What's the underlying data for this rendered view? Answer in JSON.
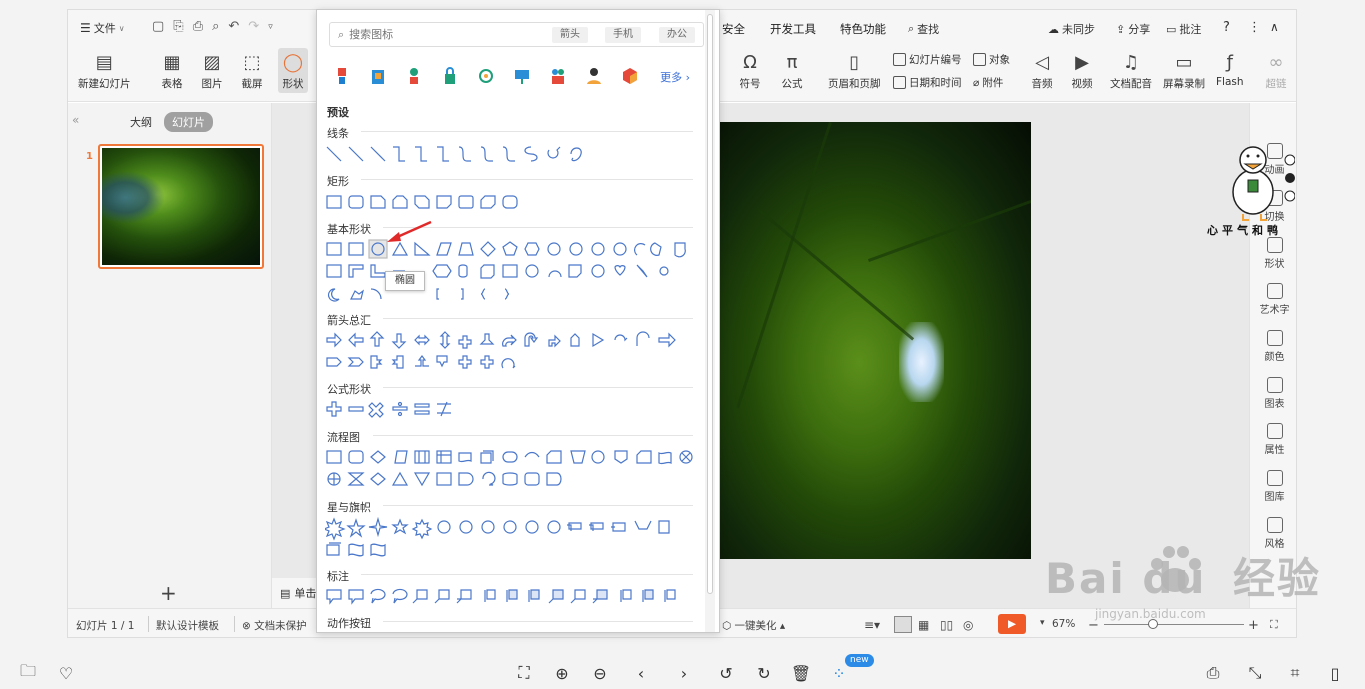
{
  "topbar": {
    "file_label": "文件",
    "tabs": [
      "安全",
      "开发工具",
      "特色功能",
      "查找"
    ],
    "sync": "未同步",
    "share": "分享",
    "comment": "批注"
  },
  "ribbon": {
    "new_slide": "新建幻灯片",
    "table": "表格",
    "picture": "图片",
    "screenshot": "截屏",
    "shape": "形状",
    "symbol": "符号",
    "formula": "公式",
    "header_footer": "页眉和页脚",
    "slide_number": "幻灯片编号",
    "object": "对象",
    "date_time": "日期和时间",
    "attachment": "附件",
    "audio": "音频",
    "video": "视频",
    "doc_voice": "文档配音",
    "screen_record": "屏幕录制",
    "flash": "Flash",
    "hyperlink": "超链"
  },
  "left_panel": {
    "outline_tab": "大纲",
    "slides_tab": "幻灯片",
    "slide_number": "1",
    "add_label": "+"
  },
  "notes_label": "单击",
  "right_panel": [
    "动画",
    "切换",
    "形状",
    "艺术字",
    "颜色",
    "图表",
    "属性",
    "图库",
    "风格"
  ],
  "statusbar": {
    "slide_count": "幻灯片 1 / 1",
    "template": "默认设计模板",
    "protect": "文档未保护",
    "beautify": "一键美化",
    "zoom": "67%"
  },
  "popup": {
    "search_placeholder": "搜索图标",
    "search_tags": [
      "箭头",
      "手机",
      "办公"
    ],
    "more_label": "更多",
    "preset_label": "预设",
    "sections": {
      "lines": "线条",
      "rect": "矩形",
      "basic": "基本形状",
      "arrows": "箭头总汇",
      "formula": "公式形状",
      "flowchart": "流程图",
      "stars": "星与旗帜",
      "callouts": "标注",
      "actions": "动作按钮"
    },
    "tooltip": "椭圆"
  },
  "duck_caption": "心平气和鸭",
  "watermark": {
    "logo": "Bai  du",
    "cn": "经验",
    "url": "jingyan.baidu.com"
  },
  "bottom_badge": "new",
  "colors": {
    "accent": "#f0793a",
    "link": "#3b6fd6",
    "play": "#f05a28"
  }
}
